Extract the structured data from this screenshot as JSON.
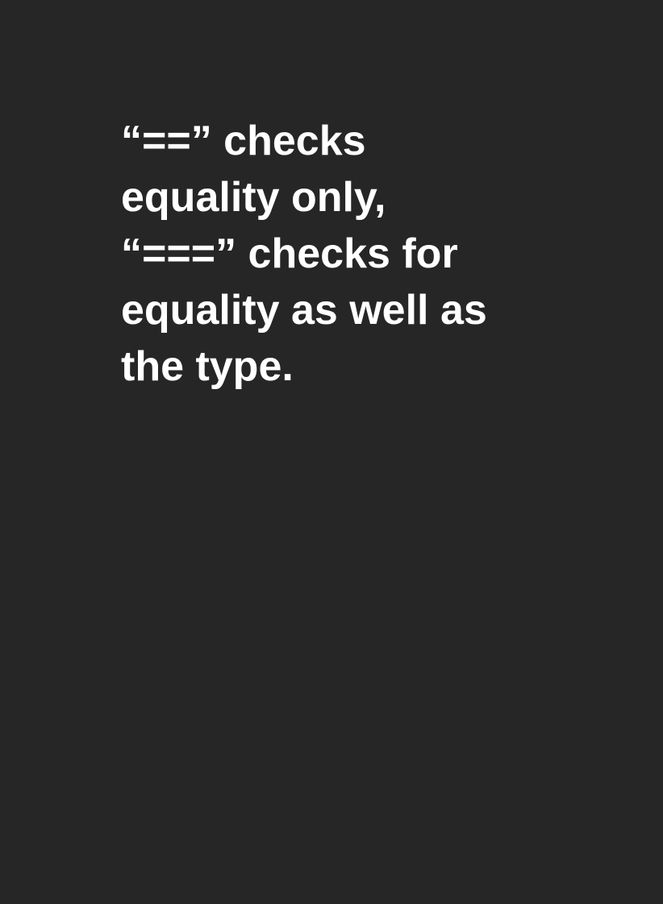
{
  "slide": {
    "background_color": "#262626",
    "text_color": "#ffffff",
    "lines": [
      "“==” checks",
      "equality only,",
      "“===” checks for",
      "equality as well as",
      "the type."
    ]
  }
}
